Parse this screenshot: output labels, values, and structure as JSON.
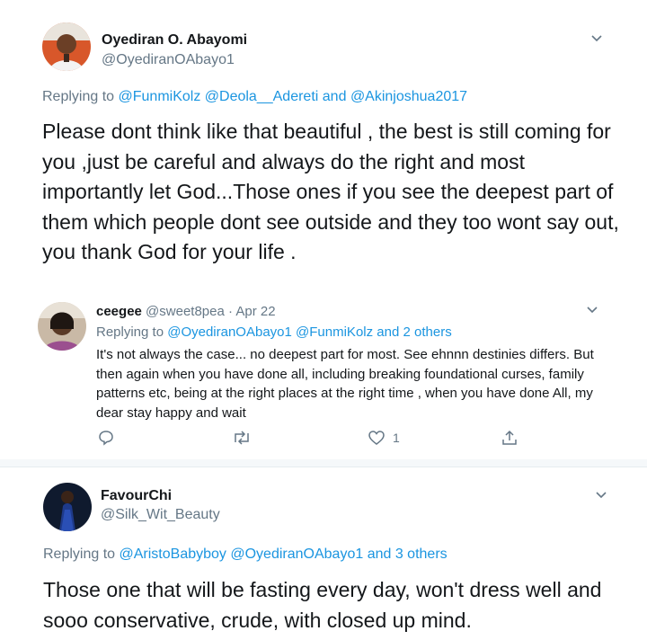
{
  "tweet1": {
    "display_name": "Oyediran O. Abayomi",
    "handle": "@OyediranOAbayo1",
    "replying_prefix": "Replying to",
    "replying_mentions": [
      "@FunmiKolz",
      "@Deola__Adereti",
      "and",
      "@Akinjoshua2017"
    ],
    "body": "Please dont think like that beautiful , the best is still coming for you ,just be careful and always do the right and most importantly let God...Those ones if you see the deepest part of them which people dont see outside and they too wont say out, you thank God for your life ."
  },
  "tweet2": {
    "display_name": "ceegee",
    "handle": "@sweet8pea",
    "separator": "·",
    "date": "Apr 22",
    "replying_prefix": "Replying to",
    "replying_mentions": [
      "@OyediranOAbayo1",
      "@FunmiKolz",
      "and 2 others"
    ],
    "body": "It's not always the case... no deepest part for most. See ehnnn destinies differs. But then again when you have done all, including breaking foundational curses, family patterns etc, being at the right places at the right time , when you have done All, my dear stay happy and wait",
    "actions": {
      "reply_icon": "reply-icon",
      "retweet_icon": "retweet-icon",
      "like_icon": "heart-icon",
      "like_count": "1",
      "share_icon": "share-icon"
    }
  },
  "tweet3": {
    "display_name": "FavourChi",
    "handle": "@Silk_Wit_Beauty",
    "replying_prefix": "Replying to",
    "replying_mentions": [
      "@AristoBabyboy",
      "@OyediranOAbayo1",
      "and 3 others"
    ],
    "body": "Those one that will be fasting every day, won't dress well and sooo conservative, crude, with closed up mind."
  },
  "colors": {
    "link": "#1b95e0",
    "secondary_text": "#657786",
    "primary_text": "#14171a"
  }
}
